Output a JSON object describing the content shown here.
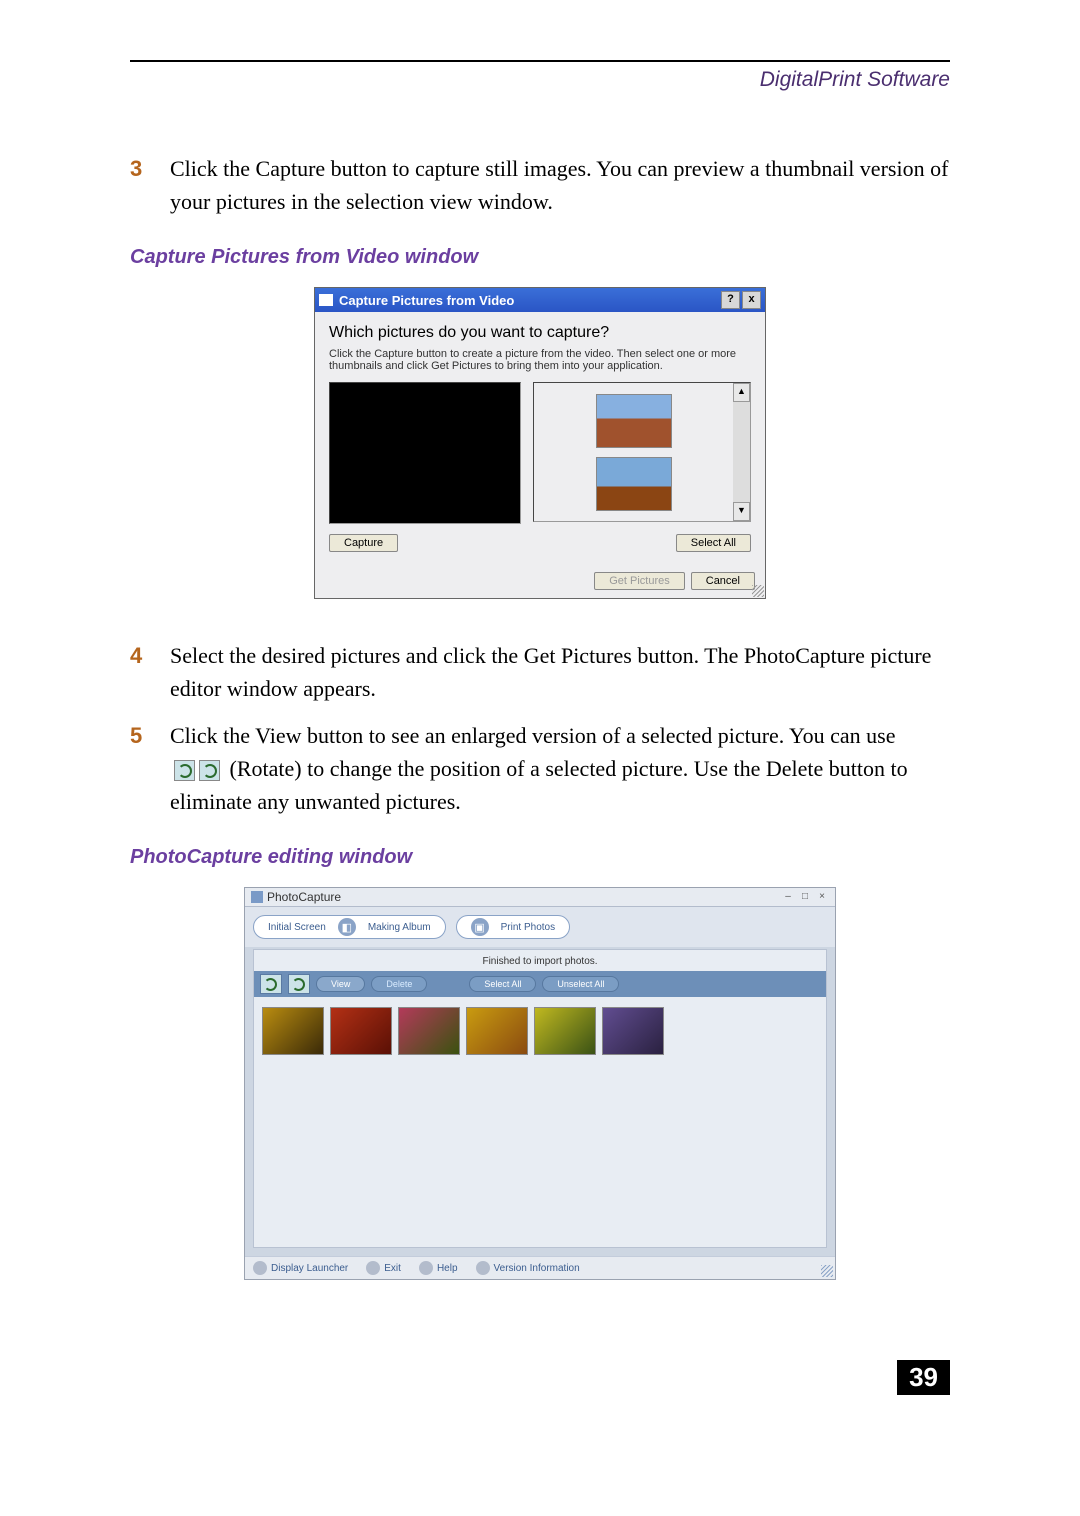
{
  "header": {
    "section": "DigitalPrint Software"
  },
  "steps": {
    "s3": {
      "num": "3",
      "text": "Click the Capture button to capture still images. You can preview a thumbnail version of your pictures in the selection view window."
    },
    "s4": {
      "num": "4",
      "text": "Select the desired pictures and click the Get Pictures button. The PhotoCapture picture editor window appears."
    },
    "s5a": {
      "num": "5",
      "textA": "Click the View button to see an enlarged version of a selected picture. You can use",
      "textB": "(Rotate) to change the position of a selected picture. Use the Delete button to eliminate any unwanted pictures."
    }
  },
  "captions": {
    "captureWindow": "Capture Pictures from Video window",
    "editWindow": "PhotoCapture editing window"
  },
  "captureDialog": {
    "title": "Capture Pictures from Video",
    "help": "?",
    "close": "x",
    "heading": "Which pictures do you want to capture?",
    "sub": "Click the Capture button to create a picture from the video.  Then select one or more thumbnails and click Get Pictures to bring them into your application.",
    "captureBtn": "Capture",
    "selectAllBtn": "Select All",
    "getPicturesBtn": "Get Pictures",
    "cancelBtn": "Cancel",
    "upArrow": "▲",
    "downArrow": "▼"
  },
  "photoCapture": {
    "title": "PhotoCapture",
    "min": "–",
    "max": "□",
    "close": "×",
    "nav": {
      "initial": "Initial Screen",
      "album": "Making Album",
      "print": "Print Photos"
    },
    "status": "Finished to import photos.",
    "toolbar": {
      "view": "View",
      "delete": "Delete",
      "selectAll": "Select All",
      "unselectAll": "Unselect All"
    },
    "footer": {
      "launcher": "Display Launcher",
      "exit": "Exit",
      "help": "Help",
      "version": "Version Information"
    }
  },
  "pageNumber": "39"
}
